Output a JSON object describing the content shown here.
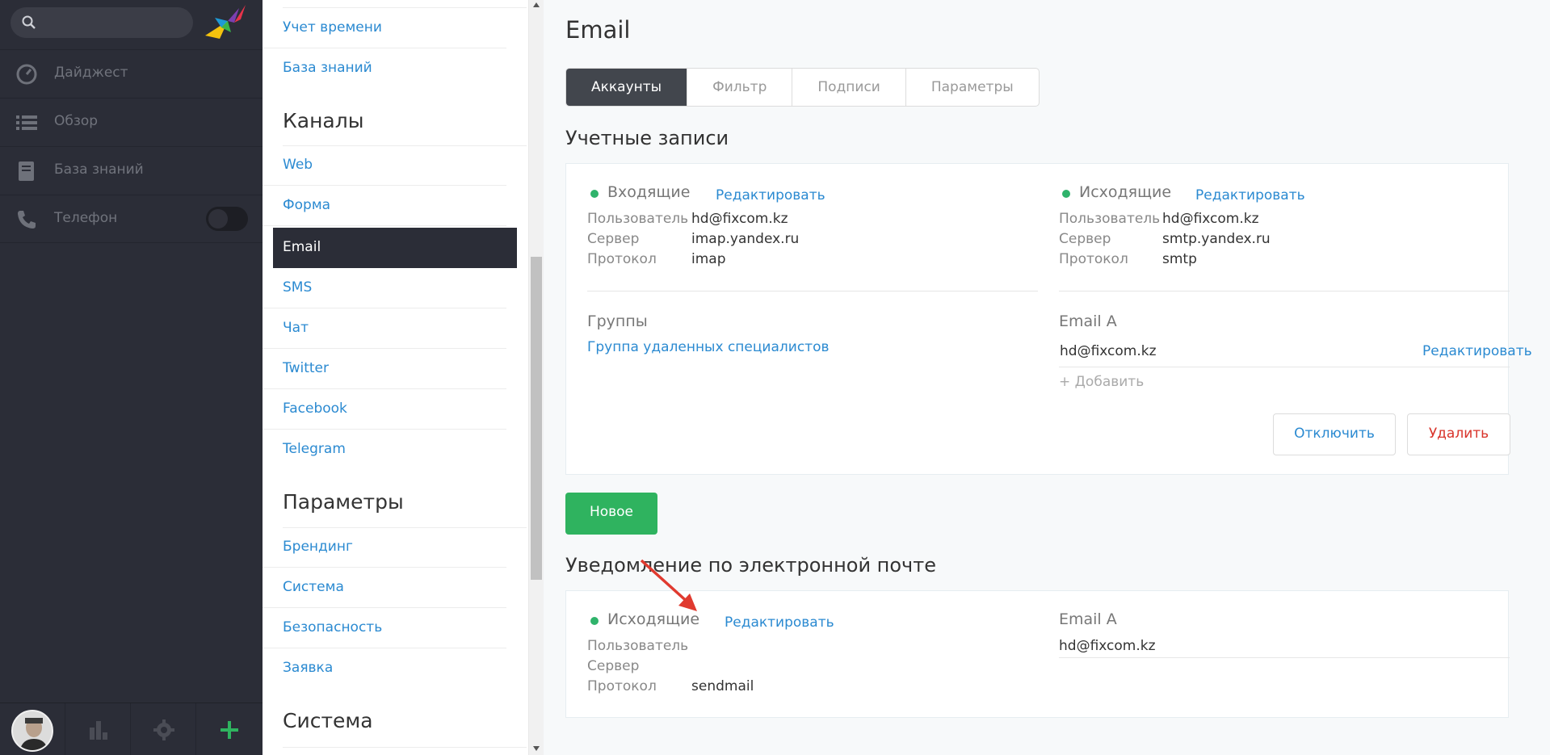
{
  "sidebar": {
    "search_placeholder": "",
    "nav": [
      {
        "label": "Дайджест",
        "icon": "gauge-icon"
      },
      {
        "label": "Обзор",
        "icon": "list-icon"
      },
      {
        "label": "База знаний",
        "icon": "book-icon"
      },
      {
        "label": "Телефон",
        "icon": "phone-icon"
      }
    ],
    "phone_toggle": "off",
    "bottom": [
      "avatar",
      "stats-icon",
      "gear-icon",
      "plus-icon"
    ]
  },
  "menu": {
    "top_links": [
      "Учет времени",
      "База знаний"
    ],
    "channels_heading": "Каналы",
    "channels": [
      "Web",
      "Форма",
      "Email",
      "SMS",
      "Чат",
      "Twitter",
      "Facebook",
      "Telegram"
    ],
    "active": "Email",
    "params_heading": "Параметры",
    "params": [
      "Брендинг",
      "Система",
      "Безопасность",
      "Заявка"
    ],
    "system_heading": "Система"
  },
  "main": {
    "title": "Email",
    "tabs": [
      "Аккаунты",
      "Фильтр",
      "Подписи",
      "Параметры"
    ],
    "active_tab": "Аккаунты",
    "accounts_title": "Учетные записи",
    "incoming": {
      "label": "Входящие",
      "edit": "Редактировать",
      "rows": [
        {
          "k": "Пользователь",
          "v": "hd@fixcom.kz"
        },
        {
          "k": "Сервер",
          "v": "imap.yandex.ru"
        },
        {
          "k": "Протокол",
          "v": "imap"
        }
      ]
    },
    "outgoing": {
      "label": "Исходящие",
      "edit": "Редактировать",
      "rows": [
        {
          "k": "Пользователь",
          "v": "hd@fixcom.kz"
        },
        {
          "k": "Сервер",
          "v": "smtp.yandex.ru"
        },
        {
          "k": "Протокол",
          "v": "smtp"
        }
      ]
    },
    "groups_label": "Группы",
    "group_link": "Группа удаленных специалистов",
    "email_a_label": "Email A",
    "email_a_value": "hd@fixcom.kz",
    "email_a_edit": "Редактировать",
    "add_label": "+ Добавить",
    "disable_btn": "Отключить",
    "delete_btn": "Удалить",
    "new_btn": "Новое",
    "notify_title": "Уведомление по электронной почте",
    "notify_out": {
      "label": "Исходящие",
      "edit": "Редактировать",
      "rows": [
        {
          "k": "Пользователь",
          "v": ""
        },
        {
          "k": "Сервер",
          "v": ""
        },
        {
          "k": "Протокол",
          "v": "sendmail"
        }
      ]
    },
    "notify_email_label": "Email A",
    "notify_email_value": "hd@fixcom.kz"
  },
  "colors": {
    "sidebar": "#2b2d37",
    "link": "#2b8ad1",
    "accent_green": "#2fb35f",
    "status_dot": "#2fb36b",
    "danger": "#d9342b"
  }
}
